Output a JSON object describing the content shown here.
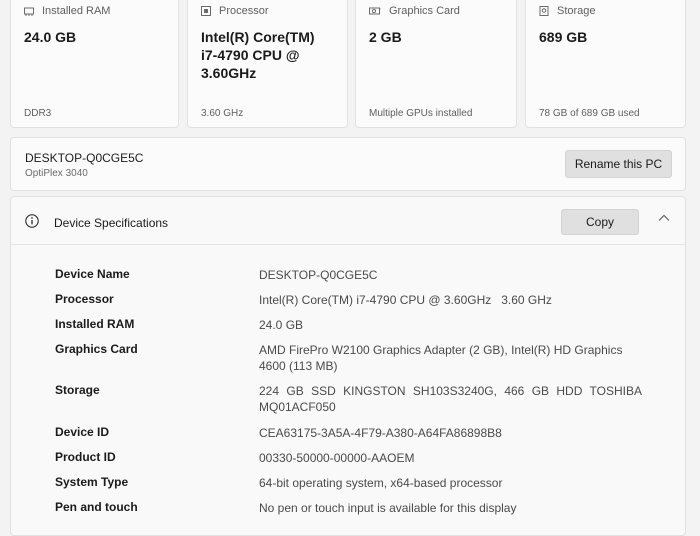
{
  "cards": [
    {
      "icon": "memory-icon",
      "title": "Installed RAM",
      "value": "24.0 GB",
      "sub": "DDR3"
    },
    {
      "icon": "processor-icon",
      "title": "Processor",
      "value": "Intel(R) Core(TM) i7-4790 CPU @ 3.60GHz",
      "sub": "3.60 GHz"
    },
    {
      "icon": "graphics-card-icon",
      "title": "Graphics Card",
      "value": "2 GB",
      "sub": "Multiple GPUs installed"
    },
    {
      "icon": "storage-icon",
      "title": "Storage",
      "value": "689 GB",
      "sub": "78 GB of 689 GB used"
    }
  ],
  "pc": {
    "name": "DESKTOP-Q0CGE5C",
    "model": "OptiPlex 3040",
    "rename_label": "Rename this PC"
  },
  "specs": {
    "title": "Device Specifications",
    "copy_label": "Copy",
    "rows": [
      {
        "label": "Device Name",
        "value": "DESKTOP-Q0CGE5C"
      },
      {
        "label": "Processor",
        "value": "Intel(R) Core(TM) i7-4790 CPU @ 3.60GHz   3.60 GHz"
      },
      {
        "label": "Installed RAM",
        "value": "24.0 GB"
      },
      {
        "label": "Graphics Card",
        "value": "AMD FirePro W2100 Graphics Adapter (2 GB), Intel(R) HD Graphics 4600 (113 MB)"
      },
      {
        "label": "Storage",
        "value": "224 GB SSD KINGSTON SH103S3240G, 466 GB HDD TOSHIBA MQ01ACF050"
      },
      {
        "label": "Device ID",
        "value": "CEA63175-3A5A-4F79-A380-A64FA86898B8"
      },
      {
        "label": "Product ID",
        "value": "00330-50000-00000-AAOEM"
      },
      {
        "label": "System Type",
        "value": "64-bit operating system, x64-based processor"
      },
      {
        "label": "Pen and touch",
        "value": "No pen or touch input is available for this display"
      }
    ]
  }
}
